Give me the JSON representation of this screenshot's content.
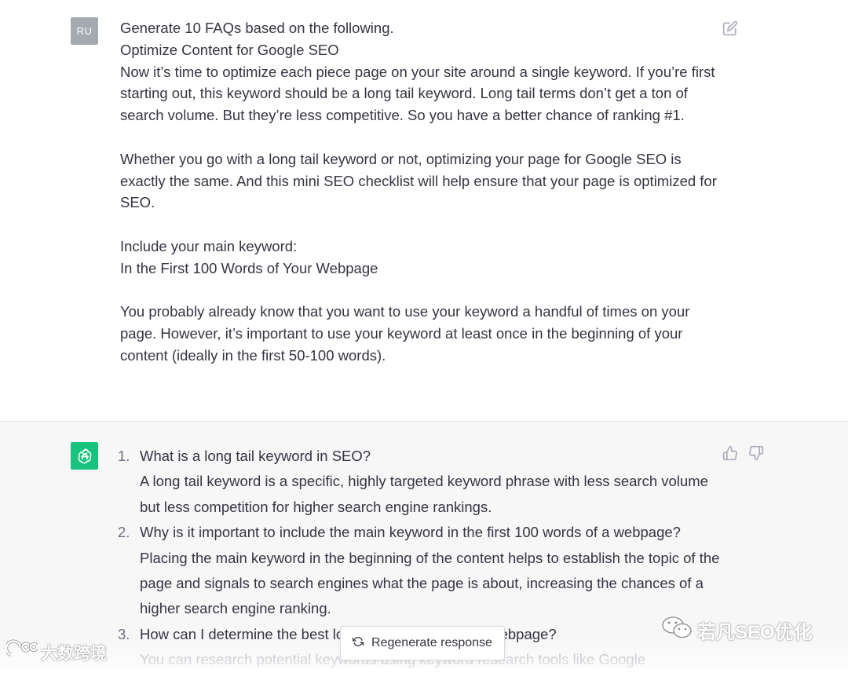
{
  "user_message": {
    "avatar_initials": "RU",
    "lines": [
      "Generate 10 FAQs based on the following.",
      "Optimize Content for Google SEO",
      "Now it’s time to optimize each piece page on your site around a single keyword. If you’re first starting out, this keyword should be a long tail keyword. Long tail terms don’t get a ton of search volume. But they’re less competitive. So you have a better chance of ranking #1.",
      "Whether you go with a long tail keyword or not, optimizing your page for Google SEO is exactly the same. And this mini SEO checklist will help ensure that your page is optimized for SEO.",
      "Include your main keyword:",
      "In the First 100 Words of Your Webpage",
      "You probably already know that you want to use your keyword a handful of times on your page. However, it’s important to use your keyword at least once in the beginning of your content (ideally in the first 50-100 words)."
    ],
    "edit_icon": "edit-icon"
  },
  "assistant_message": {
    "avatar_icon": "openai-logo-icon",
    "faqs": [
      {
        "num": "1.",
        "question": "What is a long tail keyword in SEO?",
        "answer": "A long tail keyword is a specific, highly targeted keyword phrase with less search volume but less competition for higher search engine rankings."
      },
      {
        "num": "2.",
        "question": "Why is it important to include the main keyword in the first 100 words of a webpage?",
        "answer": "Placing the main keyword in the beginning of the content helps to establish the topic of the page and signals to search engines what the page is about, increasing the chances of a higher search engine ranking."
      },
      {
        "num": "3.",
        "question": "How can I determine the best long tail keyword for my webpage?",
        "answer": "You can research potential keywords using keyword research tools like Google"
      }
    ],
    "thumbs_up_icon": "thumbs-up-icon",
    "thumbs_down_icon": "thumbs-down-icon"
  },
  "regenerate": {
    "label": "Regenerate response",
    "icon": "refresh-icon"
  },
  "watermarks": {
    "right": "若凡SEO优化",
    "left": "大数跨境"
  },
  "colors": {
    "assistant_bg": "#f7f7f8",
    "openai_green": "#19c37d",
    "user_avatar": "#a4abb0",
    "text": "#343541"
  }
}
